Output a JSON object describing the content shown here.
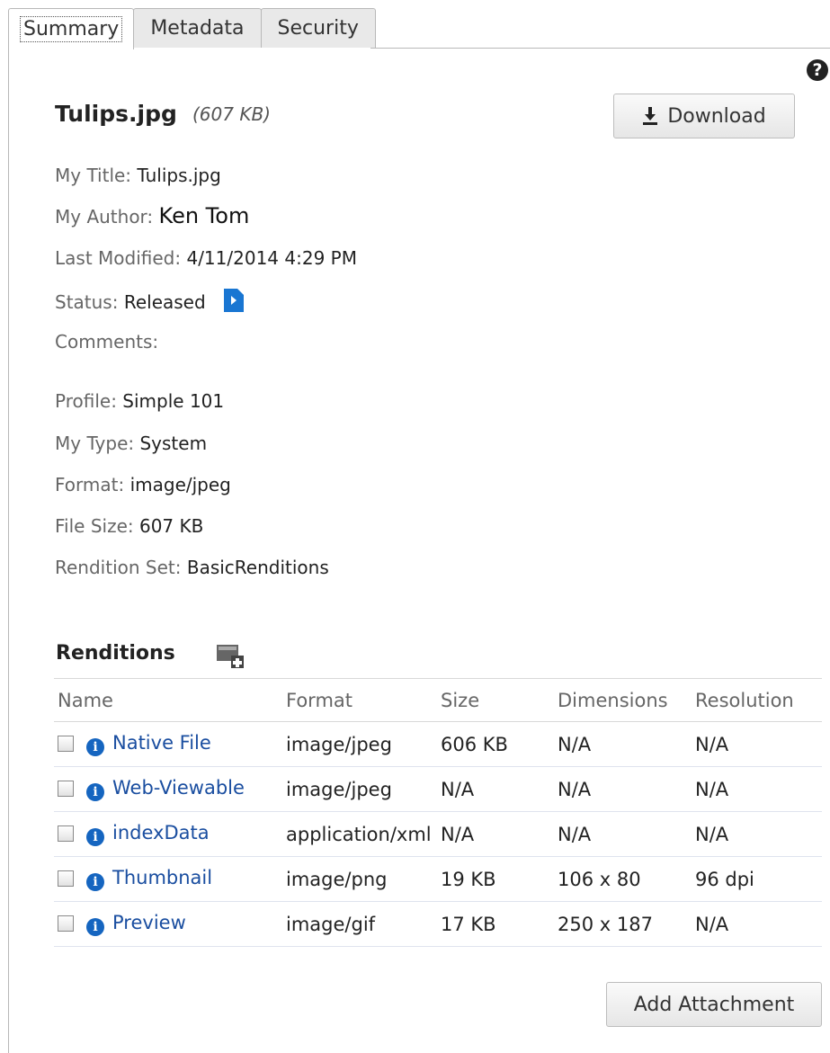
{
  "tabs": [
    "Summary",
    "Metadata",
    "Security"
  ],
  "file": {
    "name": "Tulips.jpg",
    "size": "(607 KB)"
  },
  "download_label": "Download",
  "fields": {
    "title": {
      "label": "My Title:",
      "value": "Tulips.jpg"
    },
    "author": {
      "label": "My Author:",
      "value": "Ken Tom"
    },
    "last_modified": {
      "label": "Last Modified:",
      "value": "4/11/2014 4:29 PM"
    },
    "status": {
      "label": "Status:",
      "value": "Released"
    },
    "comments": {
      "label": "Comments:",
      "value": ""
    },
    "profile": {
      "label": "Profile:",
      "value": "Simple 101"
    },
    "type": {
      "label": "My Type:",
      "value": "System"
    },
    "format": {
      "label": "Format:",
      "value": "image/jpeg"
    },
    "file_size": {
      "label": "File Size:",
      "value": "607 KB"
    },
    "rendition_set": {
      "label": "Rendition Set:",
      "value": "BasicRenditions"
    }
  },
  "renditions": {
    "title": "Renditions",
    "columns": [
      "Name",
      "Format",
      "Size",
      "Dimensions",
      "Resolution"
    ],
    "rows": [
      {
        "name": "Native File",
        "format": "image/jpeg",
        "size": "606 KB",
        "dimensions": "N/A",
        "resolution": "N/A"
      },
      {
        "name": "Web-Viewable",
        "format": "image/jpeg",
        "size": "N/A",
        "dimensions": "N/A",
        "resolution": "N/A"
      },
      {
        "name": "indexData",
        "format": "application/xml",
        "size": "N/A",
        "dimensions": "N/A",
        "resolution": "N/A"
      },
      {
        "name": "Thumbnail",
        "format": "image/png",
        "size": "19 KB",
        "dimensions": "106 x 80",
        "resolution": "96 dpi"
      },
      {
        "name": "Preview",
        "format": "image/gif",
        "size": "17 KB",
        "dimensions": "250 x 187",
        "resolution": "N/A"
      }
    ]
  },
  "add_attachment_label": "Add Attachment",
  "colors": {
    "link": "#1a4ea0",
    "info_icon": "#1565c0",
    "status_icon": "#1976d2"
  },
  "icons": {
    "help": "question-circle-icon",
    "download": "download-icon",
    "status": "workflow-arrow-icon",
    "add_rendition": "add-rendition-icon",
    "info": "info-icon"
  }
}
